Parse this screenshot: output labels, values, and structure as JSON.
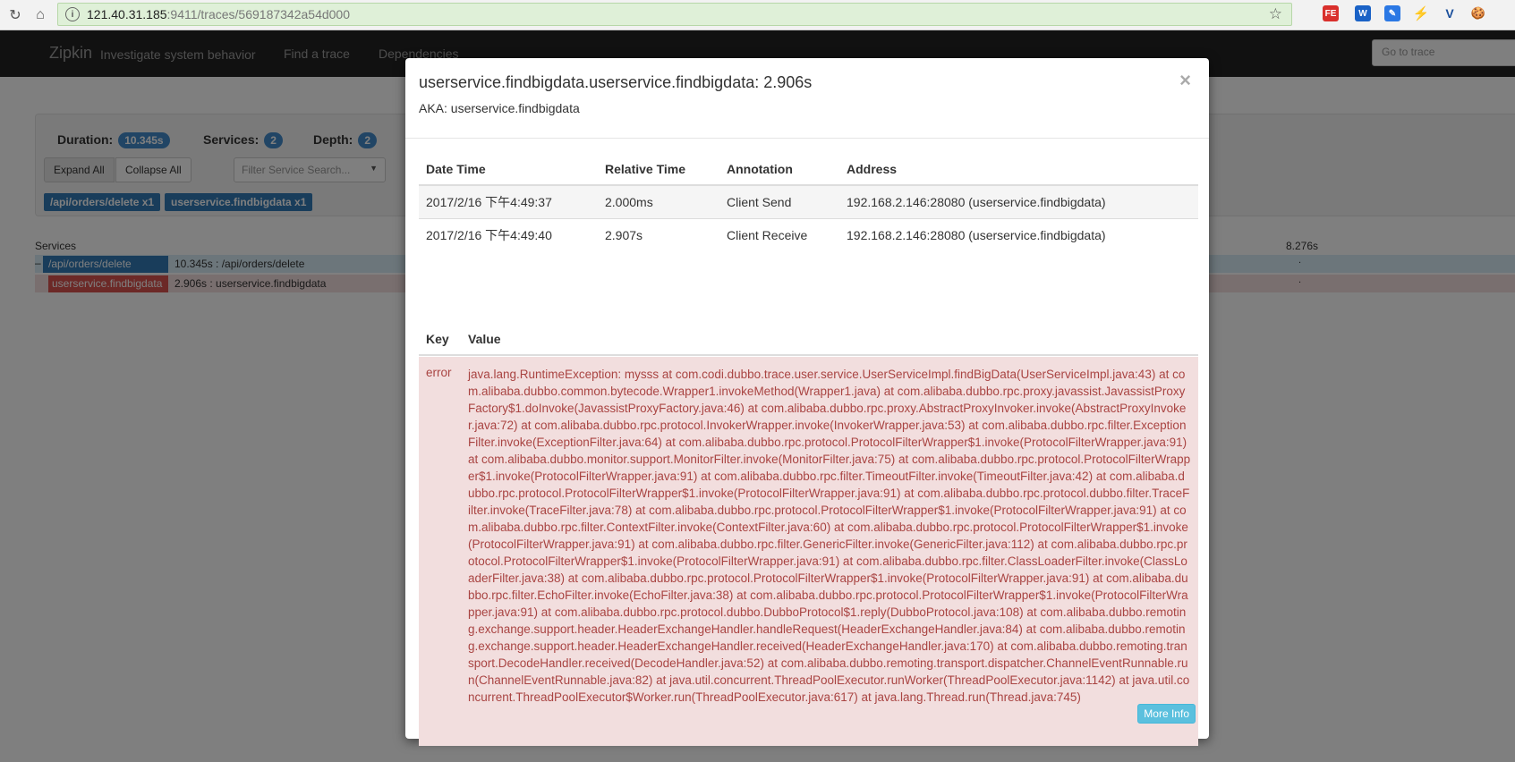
{
  "browser": {
    "url_host": "121.40.31.185",
    "url_rest": ":9411/traces/569187342a54d000",
    "extensions": [
      "FE",
      "W",
      "✎",
      "⚡",
      "V",
      "🍪"
    ]
  },
  "navbar": {
    "brand": "Zipkin",
    "tagline": "Investigate system behavior",
    "links": [
      "Find a trace",
      "Dependencies"
    ],
    "goto_placeholder": "Go to trace"
  },
  "summary": {
    "duration_label": "Duration:",
    "duration_value": "10.345s",
    "services_label": "Services:",
    "services_value": "2",
    "depth_label": "Depth:",
    "depth_value": "2",
    "expand_all": "Expand All",
    "collapse_all": "Collapse All",
    "filter_placeholder": "Filter Service Search...",
    "tags": [
      "/api/orders/delete x1",
      "userservice.findbigdata x1"
    ]
  },
  "timeline": {
    "services_header": "Services",
    "time_marker": "8.276s",
    "rows": [
      {
        "service": "/api/orders/delete",
        "label": "10.345s : /api/orders/delete"
      },
      {
        "service": "userservice.findbigdata",
        "label": "2.906s : userservice.findbigdata"
      }
    ]
  },
  "modal": {
    "title": "userservice.findbigdata.userservice.findbigdata: 2.906s",
    "aka": "AKA: userservice.findbigdata",
    "close": "×",
    "annotations_headers": [
      "Date Time",
      "Relative Time",
      "Annotation",
      "Address"
    ],
    "annotations": [
      {
        "datetime": "2017/2/16 下午4:49:37",
        "relative": "2.000ms",
        "annotation": "Client Send",
        "address": "192.168.2.146:28080 (userservice.findbigdata)"
      },
      {
        "datetime": "2017/2/16 下午4:49:40",
        "relative": "2.907s",
        "annotation": "Client Receive",
        "address": "192.168.2.146:28080 (userservice.findbigdata)"
      }
    ],
    "kv_headers": {
      "key": "Key",
      "value": "Value"
    },
    "binary": [
      {
        "key": "error",
        "value": "java.lang.RuntimeException: mysss at com.codi.dubbo.trace.user.service.UserServiceImpl.findBigData(UserServiceImpl.java:43) at com.alibaba.dubbo.common.bytecode.Wrapper1.invokeMethod(Wrapper1.java) at com.alibaba.dubbo.rpc.proxy.javassist.JavassistProxyFactory$1.doInvoke(JavassistProxyFactory.java:46) at com.alibaba.dubbo.rpc.proxy.AbstractProxyInvoker.invoke(AbstractProxyInvoker.java:72) at com.alibaba.dubbo.rpc.protocol.InvokerWrapper.invoke(InvokerWrapper.java:53) at com.alibaba.dubbo.rpc.filter.ExceptionFilter.invoke(ExceptionFilter.java:64) at com.alibaba.dubbo.rpc.protocol.ProtocolFilterWrapper$1.invoke(ProtocolFilterWrapper.java:91) at com.alibaba.dubbo.monitor.support.MonitorFilter.invoke(MonitorFilter.java:75) at com.alibaba.dubbo.rpc.protocol.ProtocolFilterWrapper$1.invoke(ProtocolFilterWrapper.java:91) at com.alibaba.dubbo.rpc.filter.TimeoutFilter.invoke(TimeoutFilter.java:42) at com.alibaba.dubbo.rpc.protocol.ProtocolFilterWrapper$1.invoke(ProtocolFilterWrapper.java:91) at com.alibaba.dubbo.rpc.protocol.dubbo.filter.TraceFilter.invoke(TraceFilter.java:78) at com.alibaba.dubbo.rpc.protocol.ProtocolFilterWrapper$1.invoke(ProtocolFilterWrapper.java:91) at com.alibaba.dubbo.rpc.filter.ContextFilter.invoke(ContextFilter.java:60) at com.alibaba.dubbo.rpc.protocol.ProtocolFilterWrapper$1.invoke(ProtocolFilterWrapper.java:91) at com.alibaba.dubbo.rpc.filter.GenericFilter.invoke(GenericFilter.java:112) at com.alibaba.dubbo.rpc.protocol.ProtocolFilterWrapper$1.invoke(ProtocolFilterWrapper.java:91) at com.alibaba.dubbo.rpc.filter.ClassLoaderFilter.invoke(ClassLoaderFilter.java:38) at com.alibaba.dubbo.rpc.protocol.ProtocolFilterWrapper$1.invoke(ProtocolFilterWrapper.java:91) at com.alibaba.dubbo.rpc.filter.EchoFilter.invoke(EchoFilter.java:38) at com.alibaba.dubbo.rpc.protocol.ProtocolFilterWrapper$1.invoke(ProtocolFilterWrapper.java:91) at com.alibaba.dubbo.rpc.protocol.dubbo.DubboProtocol$1.reply(DubboProtocol.java:108) at com.alibaba.dubbo.remoting.exchange.support.header.HeaderExchangeHandler.handleRequest(HeaderExchangeHandler.java:84) at com.alibaba.dubbo.remoting.exchange.support.header.HeaderExchangeHandler.received(HeaderExchangeHandler.java:170) at com.alibaba.dubbo.remoting.transport.DecodeHandler.received(DecodeHandler.java:52) at com.alibaba.dubbo.remoting.transport.dispatcher.ChannelEventRunnable.run(ChannelEventRunnable.java:82) at java.util.concurrent.ThreadPoolExecutor.runWorker(ThreadPoolExecutor.java:1142) at java.util.concurrent.ThreadPoolExecutor$Worker.run(ThreadPoolExecutor.java:617) at java.lang.Thread.run(Thread.java:745)"
      }
    ],
    "more_info": "More Info"
  }
}
